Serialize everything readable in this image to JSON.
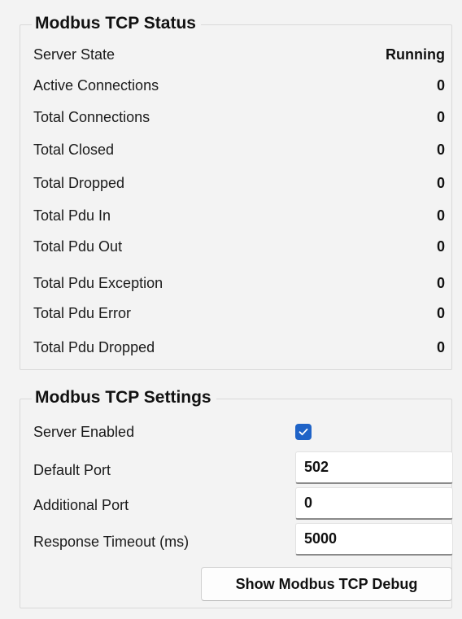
{
  "status": {
    "title": "Modbus TCP Status",
    "rows": [
      {
        "label": "Server State",
        "value": "Running"
      },
      {
        "label": "Active Connections",
        "value": "0"
      },
      {
        "label": "Total Connections",
        "value": "0"
      },
      {
        "label": "Total Closed",
        "value": "0"
      },
      {
        "label": "Total Dropped",
        "value": "0"
      },
      {
        "label": "Total Pdu In",
        "value": "0"
      },
      {
        "label": "Total Pdu Out",
        "value": "0"
      },
      {
        "label": "Total Pdu Exception",
        "value": "0"
      },
      {
        "label": "Total Pdu Error",
        "value": "0"
      },
      {
        "label": "Total Pdu Dropped",
        "value": "0"
      }
    ]
  },
  "settings": {
    "title": "Modbus TCP Settings",
    "server_enabled_label": "Server Enabled",
    "server_enabled": true,
    "default_port_label": "Default Port",
    "default_port_value": "502",
    "additional_port_label": "Additional Port",
    "additional_port_value": "0",
    "response_timeout_label": "Response Timeout (ms)",
    "response_timeout_value": "5000",
    "debug_button_label": "Show Modbus TCP Debug"
  },
  "colors": {
    "checkbox_accent": "#1f63c7",
    "background": "#f3f3f3"
  },
  "icons": {
    "checkbox": "checkmark-icon"
  }
}
